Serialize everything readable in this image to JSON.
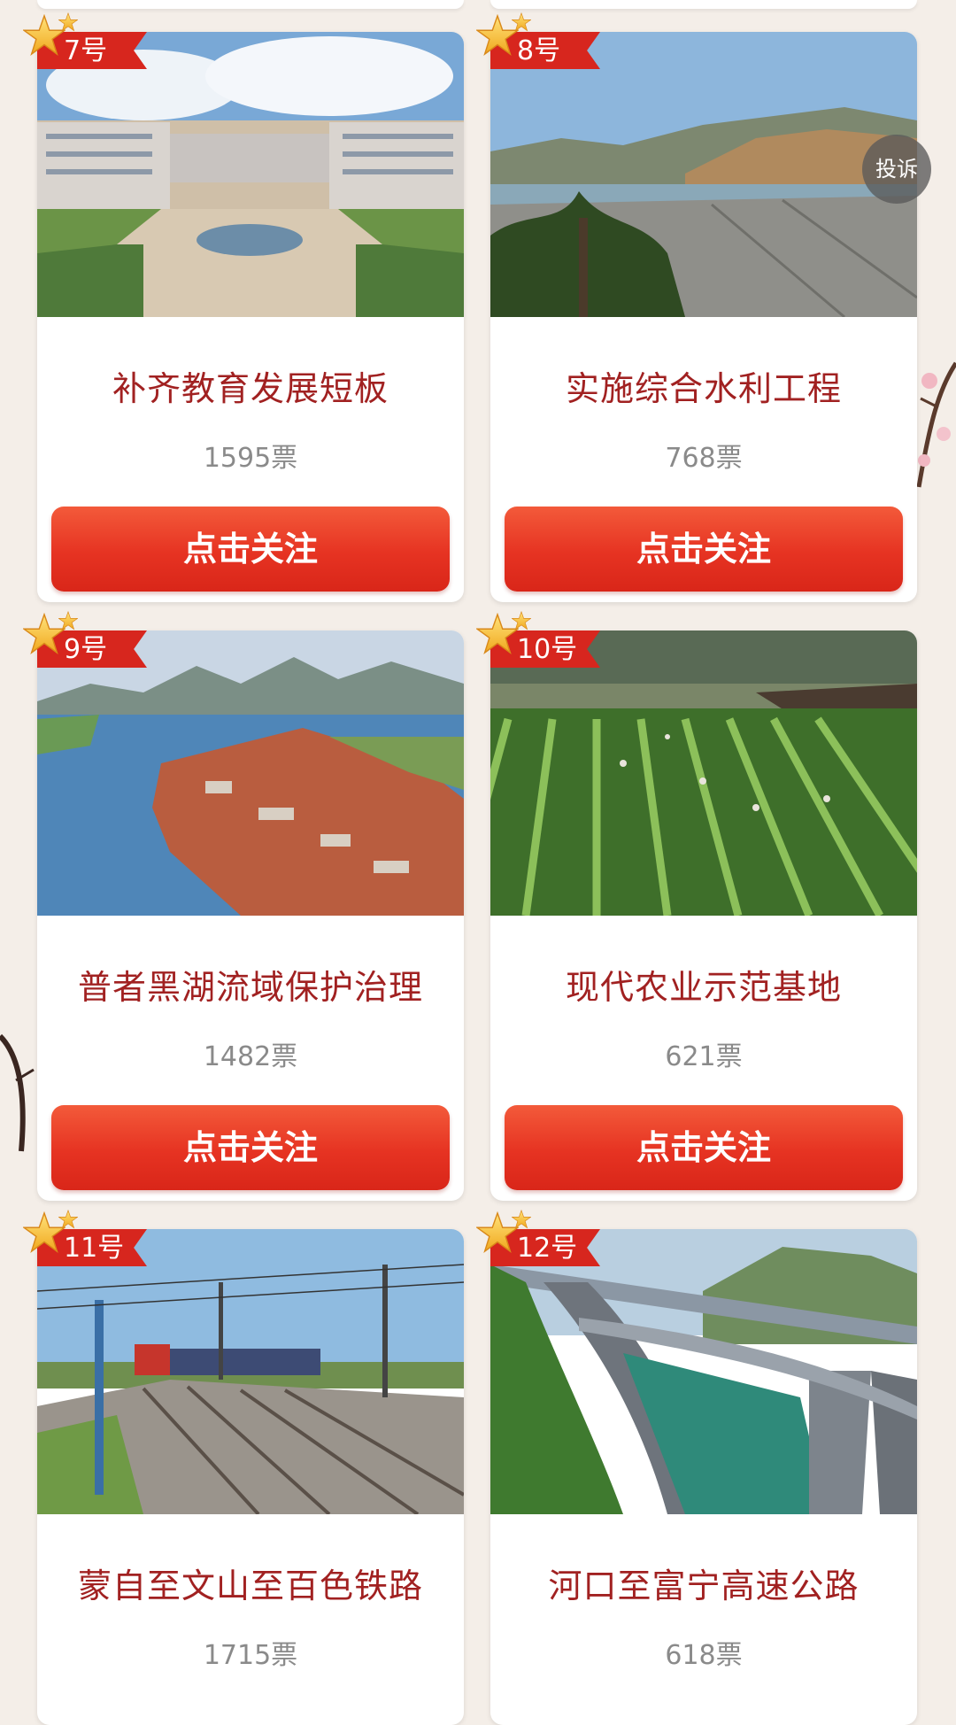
{
  "floating": {
    "complain_label": "投诉"
  },
  "button_label": "点击关注",
  "cards": [
    {
      "num": "7号",
      "title": "补齐教育发展短板",
      "votes": "1595票",
      "scene": "campus"
    },
    {
      "num": "8号",
      "title": "实施综合水利工程",
      "votes": "768票",
      "scene": "dam"
    },
    {
      "num": "9号",
      "title": "普者黑湖流域保护治理",
      "votes": "1482票",
      "scene": "lake"
    },
    {
      "num": "10号",
      "title": "现代农业示范基地",
      "votes": "621票",
      "scene": "farm"
    },
    {
      "num": "11号",
      "title": "蒙自至文山至百色铁路",
      "votes": "1715票",
      "scene": "railway"
    },
    {
      "num": "12号",
      "title": "河口至富宁高速公路",
      "votes": "618票",
      "scene": "highway"
    }
  ],
  "colors": {
    "accent": "#d7261e",
    "title_text": "#a12121",
    "votes_text": "#8a8a8a",
    "button": "#e63322"
  }
}
